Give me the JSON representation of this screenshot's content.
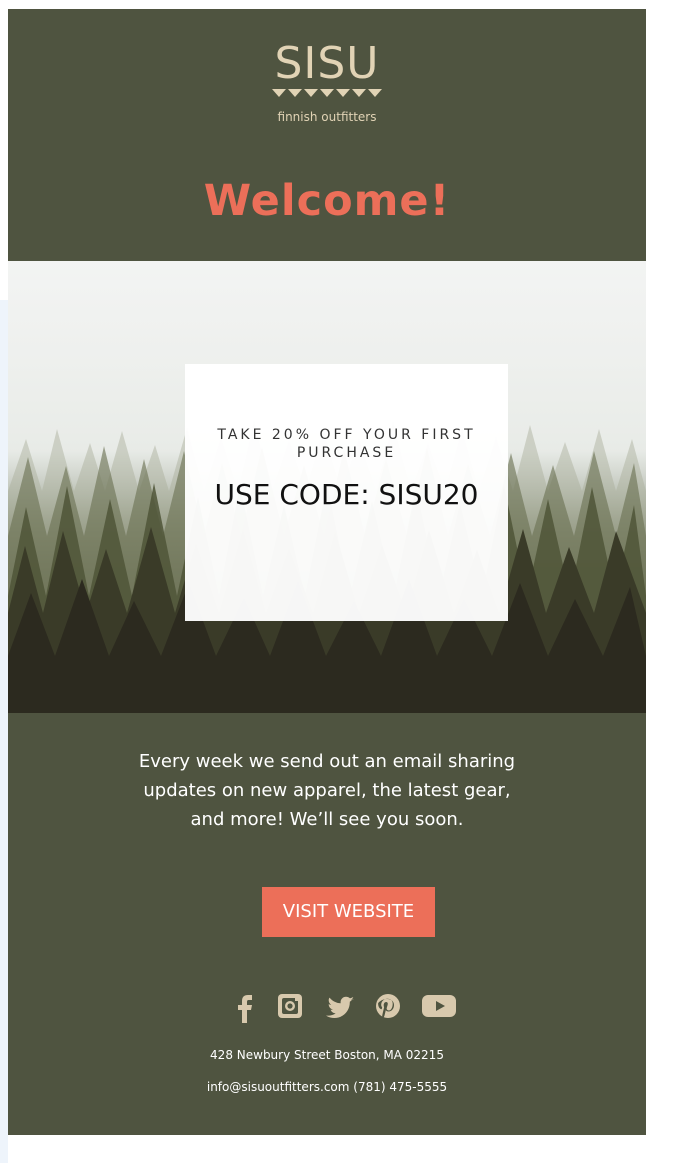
{
  "brand": {
    "name": "SISU",
    "tagline": "finnish outfitters",
    "logo_color": "#e1d3b5"
  },
  "header": {
    "welcome": "Welcome!",
    "background": "#4f5440",
    "accent": "#ec6f59"
  },
  "hero": {
    "offer": "TAKE 20% OFF YOUR FIRST PURCHASE",
    "code_label": "USE CODE: SISU20"
  },
  "body": {
    "copy": "Every week we send out an email sharing updates on new apparel, the latest gear, and more! We’ll see you soon."
  },
  "cta": {
    "label": "VISIT WEBSITE"
  },
  "social": {
    "icons": [
      "facebook-icon",
      "instagram-icon",
      "twitter-icon",
      "pinterest-icon",
      "youtube-icon"
    ],
    "icon_color": "#d8c9ad"
  },
  "footer": {
    "address": "428 Newbury Street Boston, MA 02215",
    "contact": "info@sisuoutfitters.com (781) 475-5555"
  }
}
